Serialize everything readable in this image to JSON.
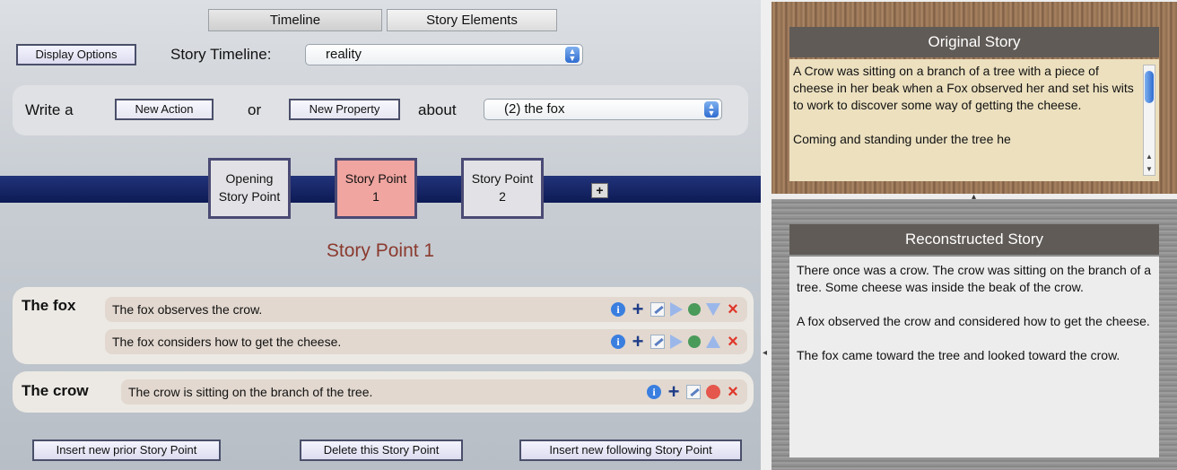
{
  "tabs": [
    {
      "label": "Timeline",
      "active": true
    },
    {
      "label": "Story Elements",
      "active": false
    }
  ],
  "toolbar": {
    "display_options": "Display Options",
    "story_timeline_label": "Story Timeline:",
    "story_timeline_value": "reality"
  },
  "write": {
    "prefix": "Write a",
    "new_action": "New Action",
    "or": "or",
    "new_property": "New Property",
    "about": "about",
    "about_value": "(2) the fox"
  },
  "story_points": [
    {
      "line1": "Opening",
      "line2": "Story Point",
      "selected": false
    },
    {
      "line1": "Story Point",
      "line2": "1",
      "selected": true
    },
    {
      "line1": "Story Point",
      "line2": "2",
      "selected": false
    }
  ],
  "add_story_point": "+",
  "current_story_point": "Story Point 1",
  "groups": [
    {
      "name": "The fox",
      "actions": [
        {
          "text": "The fox observes the crow."
        },
        {
          "text": "The fox considers how to get the cheese."
        }
      ]
    },
    {
      "name": "The crow",
      "actions": [
        {
          "text": "The crow is sitting on the branch of the tree."
        }
      ]
    }
  ],
  "bottom_buttons": {
    "insert_prior": "Insert new prior Story Point",
    "delete": "Delete this Story Point",
    "insert_following": "Insert new following Story Point"
  },
  "original_story": {
    "title": "Original Story",
    "paragraphs": [
      "A Crow was sitting on a branch of a tree with a piece of cheese in her beak when a Fox observed her and set his wits to work to discover some way of getting the cheese.",
      "Coming and standing under the tree he"
    ]
  },
  "reconstructed_story": {
    "title": "Reconstructed Story",
    "paragraphs": [
      "There once was a crow.  The crow was sitting on the branch of a tree.  Some cheese was inside the beak of the crow.",
      "A fox observed the crow and considered how to get the cheese.",
      "The fox came toward the tree and looked toward the crow."
    ]
  },
  "colors": {
    "timeline_bar": "#1a2a6c",
    "selected_story_point": "#f0a5a0",
    "story_point_title": "#8b3a2e",
    "delete_icon": "#e0362a",
    "info_icon": "#3a7fe0"
  },
  "icons": {
    "action_row_fox_1": [
      "info-icon",
      "plus-icon",
      "edit-icon",
      "play-icon",
      "green-dot-icon",
      "move-down-icon",
      "delete-icon"
    ],
    "action_row_fox_2": [
      "info-icon",
      "plus-icon",
      "edit-icon",
      "play-icon",
      "green-dot-icon",
      "move-up-icon",
      "delete-icon"
    ],
    "action_row_crow_1": [
      "info-icon",
      "plus-icon",
      "edit-icon",
      "red-dot-icon",
      "delete-icon"
    ]
  }
}
